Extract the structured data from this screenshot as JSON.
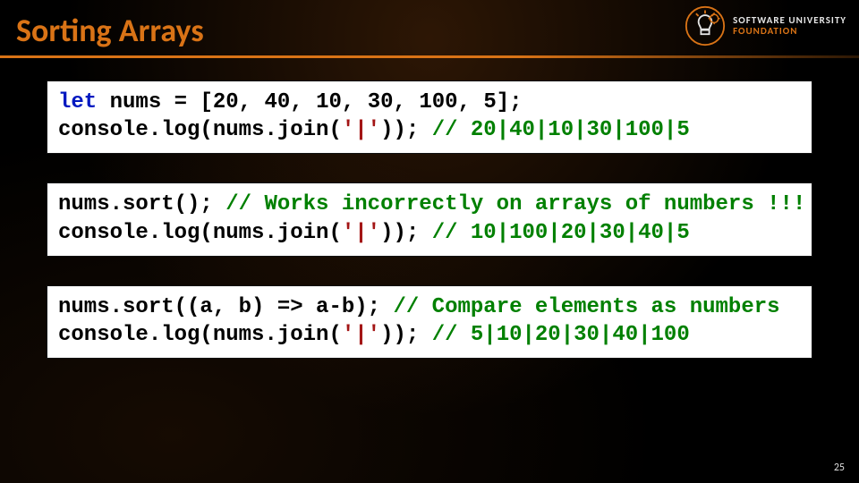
{
  "title": "Sorting Arrays",
  "logo": {
    "line1": "SOFTWARE UNIVERSITY",
    "line2": "FOUNDATION"
  },
  "page_number": "25",
  "code_blocks": [
    {
      "segments": [
        {
          "t": "let",
          "c": "kw"
        },
        {
          "t": " nums = [",
          "c": ""
        },
        {
          "t": "20",
          "c": "num"
        },
        {
          "t": ", ",
          "c": ""
        },
        {
          "t": "40",
          "c": "num"
        },
        {
          "t": ", ",
          "c": ""
        },
        {
          "t": "10",
          "c": "num"
        },
        {
          "t": ", ",
          "c": ""
        },
        {
          "t": "30",
          "c": "num"
        },
        {
          "t": ", ",
          "c": ""
        },
        {
          "t": "100",
          "c": "num"
        },
        {
          "t": ", ",
          "c": ""
        },
        {
          "t": "5",
          "c": "num"
        },
        {
          "t": "];\n",
          "c": ""
        },
        {
          "t": "console.log(nums.join(",
          "c": ""
        },
        {
          "t": "'|'",
          "c": "str"
        },
        {
          "t": ")); ",
          "c": ""
        },
        {
          "t": "// 20|40|10|30|100|5",
          "c": "cmt"
        }
      ]
    },
    {
      "segments": [
        {
          "t": "nums.sort(); ",
          "c": ""
        },
        {
          "t": "// Works incorrectly on arrays of numbers !!!",
          "c": "cmt"
        },
        {
          "t": "\nconsole.log(nums.join(",
          "c": ""
        },
        {
          "t": "'|'",
          "c": "str"
        },
        {
          "t": ")); ",
          "c": ""
        },
        {
          "t": "// 10|100|20|30|40|5",
          "c": "cmt"
        }
      ]
    },
    {
      "segments": [
        {
          "t": "nums.sort((a, b) => a-b); ",
          "c": ""
        },
        {
          "t": "// Compare elements as numbers",
          "c": "cmt"
        },
        {
          "t": "\nconsole.log(nums.join(",
          "c": ""
        },
        {
          "t": "'|'",
          "c": "str"
        },
        {
          "t": ")); ",
          "c": ""
        },
        {
          "t": "// 5|10|20|30|40|100",
          "c": "cmt"
        }
      ]
    }
  ]
}
